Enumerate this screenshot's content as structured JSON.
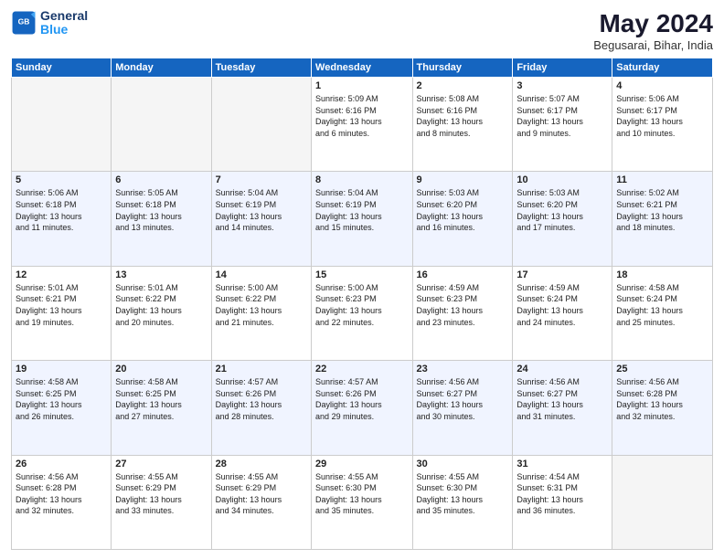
{
  "logo": {
    "line1": "General",
    "line2": "Blue"
  },
  "title": "May 2024",
  "location": "Begusarai, Bihar, India",
  "days_header": [
    "Sunday",
    "Monday",
    "Tuesday",
    "Wednesday",
    "Thursday",
    "Friday",
    "Saturday"
  ],
  "weeks": [
    {
      "alt": false,
      "days": [
        {
          "num": "",
          "info": ""
        },
        {
          "num": "",
          "info": ""
        },
        {
          "num": "",
          "info": ""
        },
        {
          "num": "1",
          "info": "Sunrise: 5:09 AM\nSunset: 6:16 PM\nDaylight: 13 hours\nand 6 minutes."
        },
        {
          "num": "2",
          "info": "Sunrise: 5:08 AM\nSunset: 6:16 PM\nDaylight: 13 hours\nand 8 minutes."
        },
        {
          "num": "3",
          "info": "Sunrise: 5:07 AM\nSunset: 6:17 PM\nDaylight: 13 hours\nand 9 minutes."
        },
        {
          "num": "4",
          "info": "Sunrise: 5:06 AM\nSunset: 6:17 PM\nDaylight: 13 hours\nand 10 minutes."
        }
      ]
    },
    {
      "alt": true,
      "days": [
        {
          "num": "5",
          "info": "Sunrise: 5:06 AM\nSunset: 6:18 PM\nDaylight: 13 hours\nand 11 minutes."
        },
        {
          "num": "6",
          "info": "Sunrise: 5:05 AM\nSunset: 6:18 PM\nDaylight: 13 hours\nand 13 minutes."
        },
        {
          "num": "7",
          "info": "Sunrise: 5:04 AM\nSunset: 6:19 PM\nDaylight: 13 hours\nand 14 minutes."
        },
        {
          "num": "8",
          "info": "Sunrise: 5:04 AM\nSunset: 6:19 PM\nDaylight: 13 hours\nand 15 minutes."
        },
        {
          "num": "9",
          "info": "Sunrise: 5:03 AM\nSunset: 6:20 PM\nDaylight: 13 hours\nand 16 minutes."
        },
        {
          "num": "10",
          "info": "Sunrise: 5:03 AM\nSunset: 6:20 PM\nDaylight: 13 hours\nand 17 minutes."
        },
        {
          "num": "11",
          "info": "Sunrise: 5:02 AM\nSunset: 6:21 PM\nDaylight: 13 hours\nand 18 minutes."
        }
      ]
    },
    {
      "alt": false,
      "days": [
        {
          "num": "12",
          "info": "Sunrise: 5:01 AM\nSunset: 6:21 PM\nDaylight: 13 hours\nand 19 minutes."
        },
        {
          "num": "13",
          "info": "Sunrise: 5:01 AM\nSunset: 6:22 PM\nDaylight: 13 hours\nand 20 minutes."
        },
        {
          "num": "14",
          "info": "Sunrise: 5:00 AM\nSunset: 6:22 PM\nDaylight: 13 hours\nand 21 minutes."
        },
        {
          "num": "15",
          "info": "Sunrise: 5:00 AM\nSunset: 6:23 PM\nDaylight: 13 hours\nand 22 minutes."
        },
        {
          "num": "16",
          "info": "Sunrise: 4:59 AM\nSunset: 6:23 PM\nDaylight: 13 hours\nand 23 minutes."
        },
        {
          "num": "17",
          "info": "Sunrise: 4:59 AM\nSunset: 6:24 PM\nDaylight: 13 hours\nand 24 minutes."
        },
        {
          "num": "18",
          "info": "Sunrise: 4:58 AM\nSunset: 6:24 PM\nDaylight: 13 hours\nand 25 minutes."
        }
      ]
    },
    {
      "alt": true,
      "days": [
        {
          "num": "19",
          "info": "Sunrise: 4:58 AM\nSunset: 6:25 PM\nDaylight: 13 hours\nand 26 minutes."
        },
        {
          "num": "20",
          "info": "Sunrise: 4:58 AM\nSunset: 6:25 PM\nDaylight: 13 hours\nand 27 minutes."
        },
        {
          "num": "21",
          "info": "Sunrise: 4:57 AM\nSunset: 6:26 PM\nDaylight: 13 hours\nand 28 minutes."
        },
        {
          "num": "22",
          "info": "Sunrise: 4:57 AM\nSunset: 6:26 PM\nDaylight: 13 hours\nand 29 minutes."
        },
        {
          "num": "23",
          "info": "Sunrise: 4:56 AM\nSunset: 6:27 PM\nDaylight: 13 hours\nand 30 minutes."
        },
        {
          "num": "24",
          "info": "Sunrise: 4:56 AM\nSunset: 6:27 PM\nDaylight: 13 hours\nand 31 minutes."
        },
        {
          "num": "25",
          "info": "Sunrise: 4:56 AM\nSunset: 6:28 PM\nDaylight: 13 hours\nand 32 minutes."
        }
      ]
    },
    {
      "alt": false,
      "days": [
        {
          "num": "26",
          "info": "Sunrise: 4:56 AM\nSunset: 6:28 PM\nDaylight: 13 hours\nand 32 minutes."
        },
        {
          "num": "27",
          "info": "Sunrise: 4:55 AM\nSunset: 6:29 PM\nDaylight: 13 hours\nand 33 minutes."
        },
        {
          "num": "28",
          "info": "Sunrise: 4:55 AM\nSunset: 6:29 PM\nDaylight: 13 hours\nand 34 minutes."
        },
        {
          "num": "29",
          "info": "Sunrise: 4:55 AM\nSunset: 6:30 PM\nDaylight: 13 hours\nand 35 minutes."
        },
        {
          "num": "30",
          "info": "Sunrise: 4:55 AM\nSunset: 6:30 PM\nDaylight: 13 hours\nand 35 minutes."
        },
        {
          "num": "31",
          "info": "Sunrise: 4:54 AM\nSunset: 6:31 PM\nDaylight: 13 hours\nand 36 minutes."
        },
        {
          "num": "",
          "info": ""
        }
      ]
    }
  ]
}
